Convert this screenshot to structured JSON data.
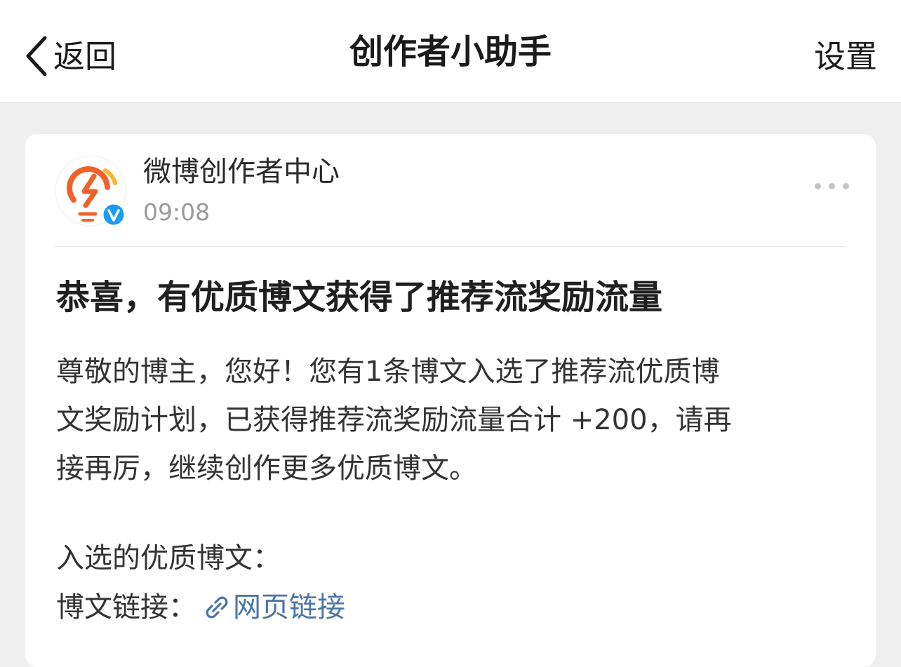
{
  "navbar": {
    "back_label": "返回",
    "title": "创作者小助手",
    "settings_label": "设置"
  },
  "message": {
    "sender_name": "微博创作者中心",
    "time": "09:08",
    "title": "恭喜，有优质博文获得了推荐流奖励流量",
    "body_lines": [
      "尊敬的博主，您好！您有1条博文入选了推荐流优质博",
      "文奖励计划，已获得推荐流奖励流量合计 +200，请再",
      "接再厉，继续创作更多优质博文。"
    ],
    "selected_label": "入选的优质博文：",
    "link_label": "博文链接：",
    "link_text": "网页链接"
  },
  "icons": {
    "back": "chevron-left-icon",
    "more": "more-dots-icon",
    "avatar": "lightning-bulb-logo",
    "verified": "verified-badge-icon",
    "link": "link-icon"
  },
  "colors": {
    "link": "#4a74a8",
    "verified": "#1d9bf0",
    "logo_orange": "#f0622a",
    "logo_yellow": "#f7b731"
  }
}
